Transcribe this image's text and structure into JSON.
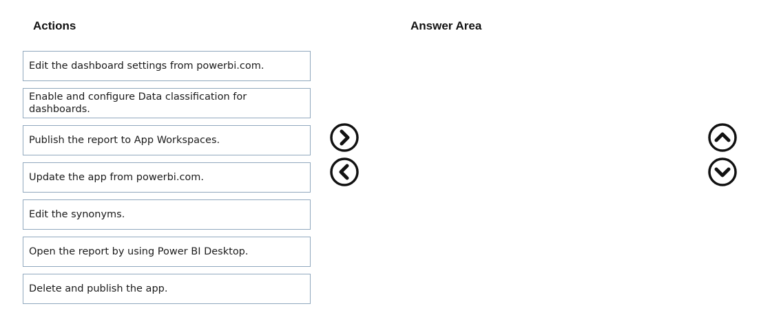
{
  "headings": {
    "actions": "Actions",
    "answer_area": "Answer Area"
  },
  "actions": [
    {
      "label": "Edit the dashboard settings from powerbi.com."
    },
    {
      "label": "Enable and configure Data classification for dashboards."
    },
    {
      "label": "Publish the report to App Workspaces."
    },
    {
      "label": "Update the app from powerbi.com."
    },
    {
      "label": "Edit the synonyms."
    },
    {
      "label": "Open the report by using Power BI Desktop."
    },
    {
      "label": "Delete and publish the app."
    }
  ],
  "answer_area": {
    "items": []
  },
  "controls": {
    "move_right_icon": "chevron-right-circle-icon",
    "move_left_icon": "chevron-left-circle-icon",
    "move_up_icon": "chevron-up-circle-icon",
    "move_down_icon": "chevron-down-circle-icon"
  },
  "colors": {
    "item_border": "#8fa7bd",
    "icon": "#111111"
  }
}
